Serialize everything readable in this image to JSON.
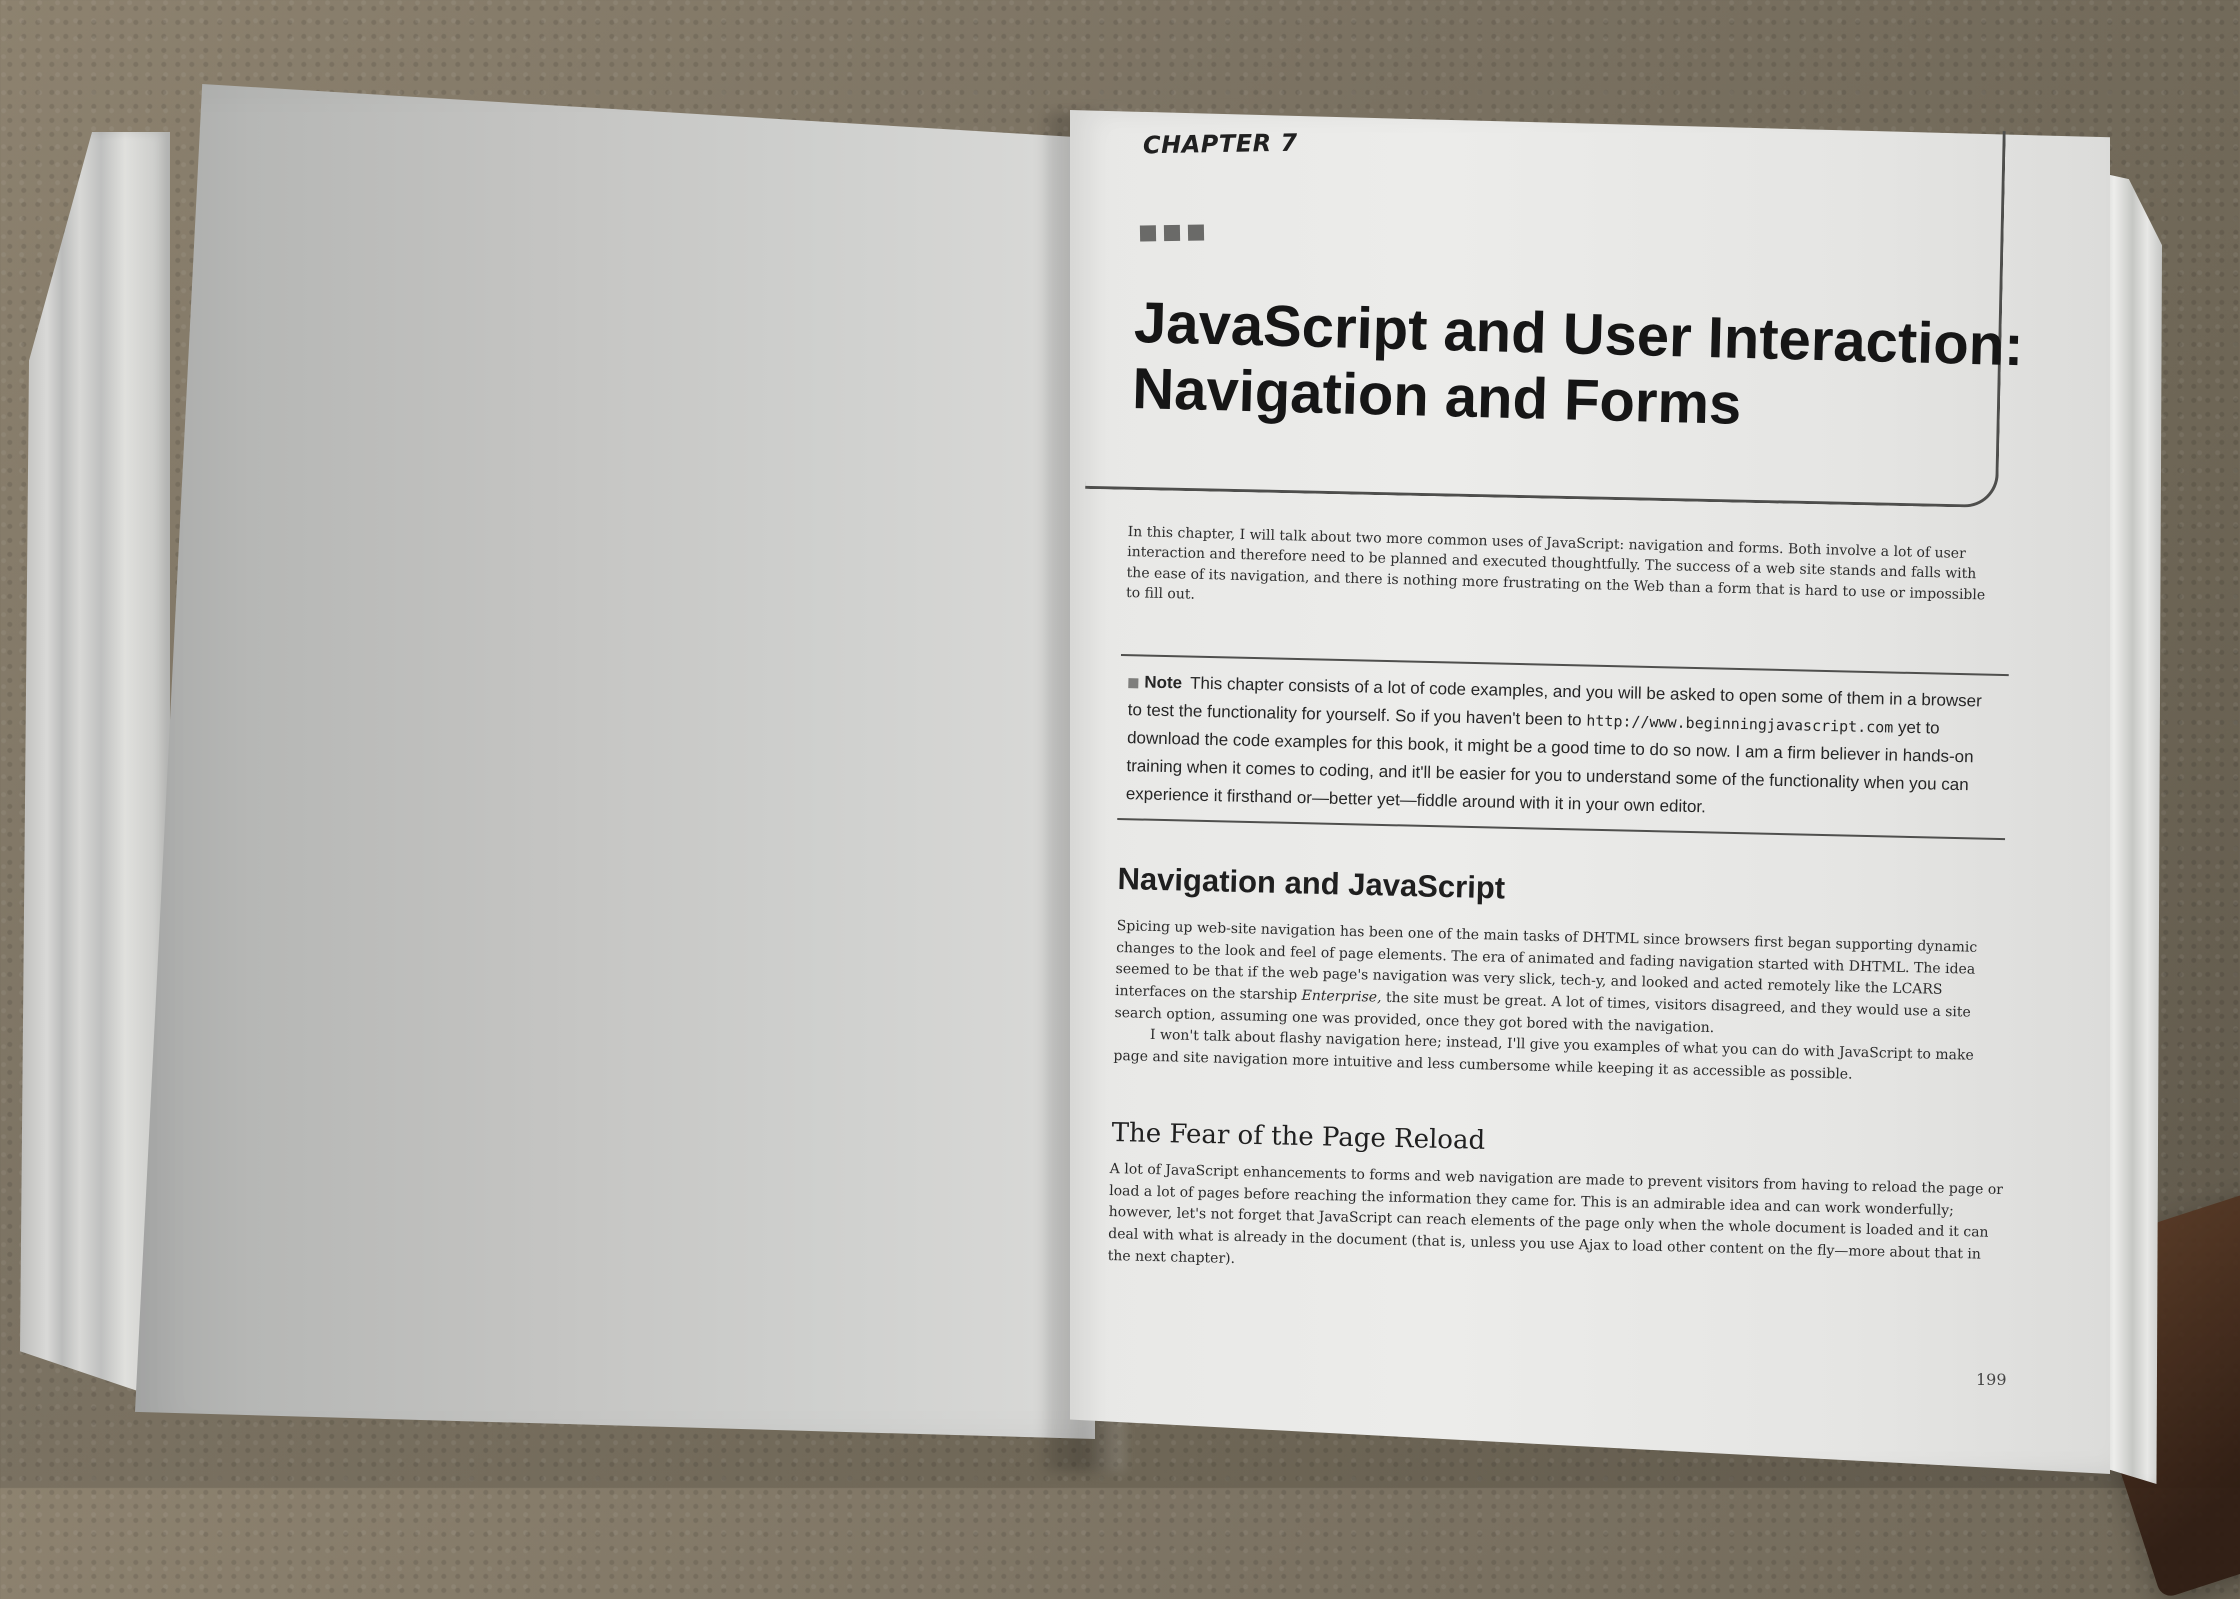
{
  "chapter": {
    "label": "CHAPTER 7",
    "title_lines": [
      "JavaScript and User Interaction:",
      "Navigation and Forms"
    ]
  },
  "intro": {
    "text": "In this chapter, I will talk about two more common uses of JavaScript: navigation and forms. Both involve a lot of user interaction and therefore need to be planned and executed thoughtfully. The success of a web site stands and falls with the ease of its navigation, and there is nothing more frustrating on the Web than a form that is hard to use or impossible to fill out."
  },
  "note": {
    "label": "Note",
    "text_before_url": "This chapter consists of a lot of code examples, and you will be asked to open some of them in a browser to test the functionality for yourself. So if you haven't been to ",
    "url": "http://www.beginningjavascript.com",
    "text_after_url": " yet to download the code examples for this book, it might be a good time to do so now. I am a firm believer in hands-on training when it comes to coding, and it'll be easier for you to understand some of the functionality when you can experience it firsthand or—better yet—fiddle around with it in your own editor."
  },
  "navigation_section": {
    "heading": "Navigation and JavaScript",
    "paragraph1_before_emphasis": "Spicing up web-site navigation has been one of the main tasks of DHTML since browsers first began supporting dynamic changes to the look and feel of page elements. The era of animated and fading navigation started with DHTML. The idea seemed to be that if the web page's navigation was very slick, tech-y, and looked and acted remotely like the LCARS interfaces on the starship ",
    "paragraph1_emphasis": "Enterprise,",
    "paragraph1_after_emphasis": " the site must be great. A lot of times, visitors disagreed, and they would use a site search option, assuming one was provided, once they got bored with the navigation.",
    "paragraph2": "I won't talk about flashy navigation here; instead, I'll give you examples of what you can do with JavaScript to make page and site navigation more intuitive and less cumbersome while keeping it as accessible as possible."
  },
  "page_reload_section": {
    "heading": "The Fear of the Page Reload",
    "paragraph": "A lot of JavaScript enhancements to forms and web navigation are made to prevent visitors from having to reload the page or load a lot of pages before reaching the information they came for. This is an admirable idea and can work wonderfully; however, let's not forget that JavaScript can reach elements of the page only when the whole document is loaded and it can deal with what is already in the document (that is, unless you use Ajax to load other content on the fly—more about that in the next chapter)."
  },
  "page": {
    "number": "199"
  }
}
